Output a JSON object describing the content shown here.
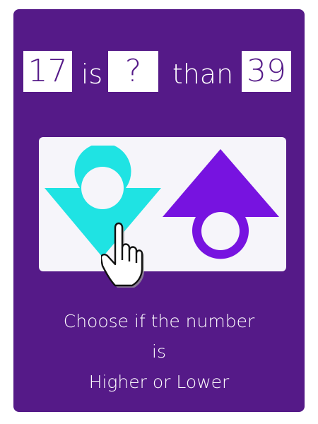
{
  "question": {
    "left_number": "17",
    "word_is": "is",
    "unknown": "?",
    "word_than": "than",
    "right_number": "39"
  },
  "buttons": {
    "lower_icon": "down-arrow-icon",
    "higher_icon": "up-arrow-icon"
  },
  "instructions": {
    "line1": "Choose if the number",
    "line2": "is",
    "line3": "Higher or Lower"
  },
  "colors": {
    "card_background": "#551a88",
    "panel_background": "#f6f5fa",
    "lower_arrow": "#1fe3e3",
    "higher_arrow": "#7713e0",
    "text_light": "#ffffff"
  }
}
